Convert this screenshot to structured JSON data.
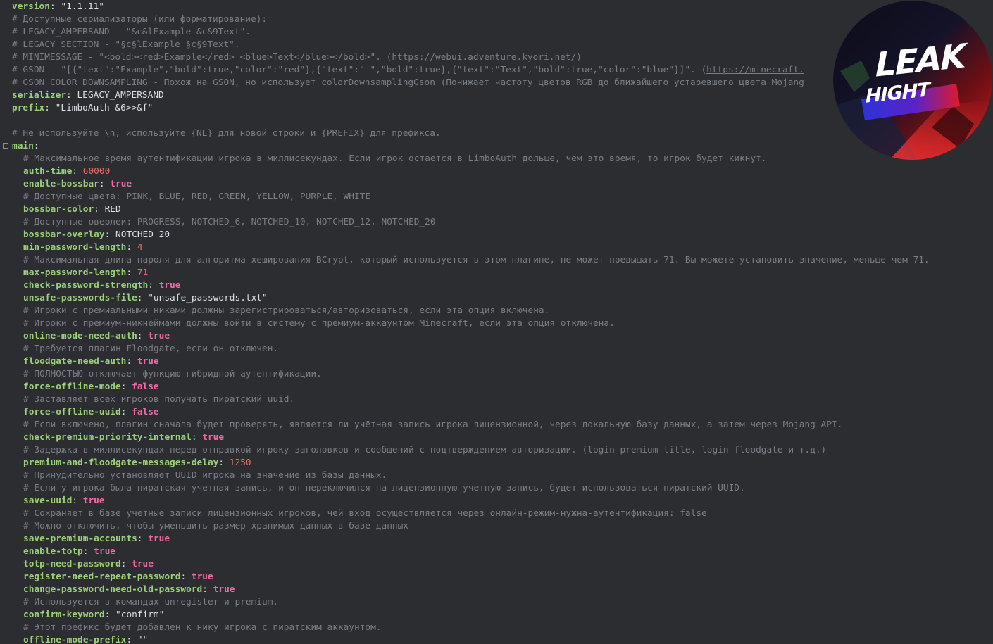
{
  "file": {
    "lines": [
      [
        {
          "t": "version",
          "c": "k"
        },
        {
          "t": ": ",
          "c": "p"
        },
        {
          "t": "\"1.1.11\"",
          "c": "s"
        }
      ],
      [
        {
          "t": "# Доступные сериализаторы (или форматирование):",
          "c": "c"
        }
      ],
      [
        {
          "t": "# LEGACY_AMPERSAND - \"&c&lExample &c&9Text\".",
          "c": "c"
        }
      ],
      [
        {
          "t": "# LEGACY_SECTION - \"§c§lExample §c§9Text\".",
          "c": "c"
        }
      ],
      [
        {
          "t": "# MINIMESSAGE - \"<bold><red>Example</red> <blue>Text</blue></bold>\". (",
          "c": "c"
        },
        {
          "t": "https://webui.adventure.kyori.net/",
          "c": "c u"
        },
        {
          "t": ")",
          "c": "c"
        }
      ],
      [
        {
          "t": "# GSON - \"[{\"text\":\"Example\",\"bold\":true,\"color\":\"red\"},{\"text\":\" \",\"bold\":true},{\"text\":\"Text\",\"bold\":true,\"color\":\"blue\"}]\". (",
          "c": "c"
        },
        {
          "t": "https://minecraft.",
          "c": "c u"
        }
      ],
      [
        {
          "t": "# GSON_COLOR_DOWNSAMPLING - Похож на GSON, но использует colorDownsamplingGson (Понижает частоту цветов RGB до ближайшего устаревшего цвета Mojang",
          "c": "c"
        }
      ],
      [
        {
          "t": "serializer",
          "c": "k"
        },
        {
          "t": ": ",
          "c": "p"
        },
        {
          "t": "LEGACY_AMPERSAND",
          "c": "s"
        }
      ],
      [
        {
          "t": "prefix",
          "c": "k"
        },
        {
          "t": ": ",
          "c": "p"
        },
        {
          "t": "\"LimboAuth &6>>&f\"",
          "c": "s"
        }
      ],
      [],
      [
        {
          "t": "# Не используйте \\n, используйте {NL} для новой строки и {PREFIX} для префикса.",
          "c": "c"
        }
      ],
      [
        {
          "t": "main",
          "c": "k"
        },
        {
          "t": ":",
          "c": "p"
        }
      ],
      [
        {
          "t": "# Максимальное время аутентификации игрока в миллисекундах. Если игрок остается в LimboAuth дольше, чем это время, то игрок будет кикнут.",
          "c": "c"
        }
      ],
      [
        {
          "t": "auth-time",
          "c": "k"
        },
        {
          "t": ": ",
          "c": "p"
        },
        {
          "t": "60000",
          "c": "n"
        }
      ],
      [
        {
          "t": "enable-bossbar",
          "c": "k"
        },
        {
          "t": ": ",
          "c": "p"
        },
        {
          "t": "true",
          "c": "b"
        }
      ],
      [
        {
          "t": "# Доступные цвета: PINK, BLUE, RED, GREEN, YELLOW, PURPLE, WHITE",
          "c": "c"
        }
      ],
      [
        {
          "t": "bossbar-color",
          "c": "k"
        },
        {
          "t": ": ",
          "c": "p"
        },
        {
          "t": "RED",
          "c": "s"
        }
      ],
      [
        {
          "t": "# Доступные оверлеи: PROGRESS, NOTCHED_6, NOTCHED_10, NOTCHED_12, NOTCHED_20",
          "c": "c"
        }
      ],
      [
        {
          "t": "bossbar-overlay",
          "c": "k"
        },
        {
          "t": ": ",
          "c": "p"
        },
        {
          "t": "NOTCHED_20",
          "c": "s"
        }
      ],
      [
        {
          "t": "min-password-length",
          "c": "k"
        },
        {
          "t": ": ",
          "c": "p"
        },
        {
          "t": "4",
          "c": "n"
        }
      ],
      [
        {
          "t": "# Максимальная длина пароля для алгоритма хеширования BCrypt, который используется в этом плагине, не может превышать 71. Вы можете установить значение, меньше чем 71.",
          "c": "c"
        }
      ],
      [
        {
          "t": "max-password-length",
          "c": "k"
        },
        {
          "t": ": ",
          "c": "p"
        },
        {
          "t": "71",
          "c": "n"
        }
      ],
      [
        {
          "t": "check-password-strength",
          "c": "k"
        },
        {
          "t": ": ",
          "c": "p"
        },
        {
          "t": "true",
          "c": "b"
        }
      ],
      [
        {
          "t": "unsafe-passwords-file",
          "c": "k"
        },
        {
          "t": ": ",
          "c": "p"
        },
        {
          "t": "\"unsafe_passwords.txt\"",
          "c": "s"
        }
      ],
      [
        {
          "t": "# Игроки с премиальными никами должны зарегистрироваться/авторизоваться, если эта опция включена.",
          "c": "c"
        }
      ],
      [
        {
          "t": "# Игроки с премиум-никнеймами должны войти в систему с премиум-аккаунтом Minecraft, если эта опция отключена.",
          "c": "c"
        }
      ],
      [
        {
          "t": "online-mode-need-auth",
          "c": "k"
        },
        {
          "t": ": ",
          "c": "p"
        },
        {
          "t": "true",
          "c": "b"
        }
      ],
      [
        {
          "t": "# Требуется плагин Floodgate, если он отключен.",
          "c": "c"
        }
      ],
      [
        {
          "t": "floodgate-need-auth",
          "c": "k"
        },
        {
          "t": ": ",
          "c": "p"
        },
        {
          "t": "true",
          "c": "b"
        }
      ],
      [
        {
          "t": "# ПОЛНОСТЬЮ отключает функцию гибридной аутентификации.",
          "c": "c"
        }
      ],
      [
        {
          "t": "force-offline-mode",
          "c": "k"
        },
        {
          "t": ": ",
          "c": "p"
        },
        {
          "t": "false",
          "c": "b"
        }
      ],
      [
        {
          "t": "# Заставляет всех игроков получать пиратский uuid.",
          "c": "c"
        }
      ],
      [
        {
          "t": "force-offline-uuid",
          "c": "k"
        },
        {
          "t": ": ",
          "c": "p"
        },
        {
          "t": "false",
          "c": "b"
        }
      ],
      [
        {
          "t": "# Если включено, плагин сначала будет проверять, является ли учётная запись игрока лицензионной, через локальную базу данных, а затем через Mojang API.",
          "c": "c"
        }
      ],
      [
        {
          "t": "check-premium-priority-internal",
          "c": "k"
        },
        {
          "t": ": ",
          "c": "p"
        },
        {
          "t": "true",
          "c": "b"
        }
      ],
      [
        {
          "t": "# Задержка в миллисекундах перед отправкой игроку заголовков и сообщений с подтверждением авторизации. (login-premium-title, login-floodgate и т.д.)",
          "c": "c"
        }
      ],
      [
        {
          "t": "premium-and-floodgate-messages-delay",
          "c": "k"
        },
        {
          "t": ": ",
          "c": "p"
        },
        {
          "t": "1250",
          "c": "n"
        }
      ],
      [
        {
          "t": "# Принудительно установляет UUID игрока на значение из базы данных.",
          "c": "c"
        }
      ],
      [
        {
          "t": "# Если у игрока была пиратская учетная запись, и он переключился на лицензионную учетную запись, будет использоваться пиратский UUID.",
          "c": "c"
        }
      ],
      [
        {
          "t": "save-uuid",
          "c": "k"
        },
        {
          "t": ": ",
          "c": "p"
        },
        {
          "t": "true",
          "c": "b"
        }
      ],
      [
        {
          "t": "# Сохраняет в базе учетные записи лицензионных игроков, чей вход осуществляется через онлайн-режим-нужна-аутентификация: false",
          "c": "c"
        }
      ],
      [
        {
          "t": "# Можно отключить, чтобы уменьшить размер хранимых данных в базе данных",
          "c": "c"
        }
      ],
      [
        {
          "t": "save-premium-accounts",
          "c": "k"
        },
        {
          "t": ": ",
          "c": "p"
        },
        {
          "t": "true",
          "c": "b"
        }
      ],
      [
        {
          "t": "enable-totp",
          "c": "k"
        },
        {
          "t": ": ",
          "c": "p"
        },
        {
          "t": "true",
          "c": "b"
        }
      ],
      [
        {
          "t": "totp-need-password",
          "c": "k"
        },
        {
          "t": ": ",
          "c": "p"
        },
        {
          "t": "true",
          "c": "b"
        }
      ],
      [
        {
          "t": "register-need-repeat-password",
          "c": "k"
        },
        {
          "t": ": ",
          "c": "p"
        },
        {
          "t": "true",
          "c": "b"
        }
      ],
      [
        {
          "t": "change-password-need-old-password",
          "c": "k"
        },
        {
          "t": ": ",
          "c": "p"
        },
        {
          "t": "true",
          "c": "b"
        }
      ],
      [
        {
          "t": "# Используется в командах unregister и premium.",
          "c": "c"
        }
      ],
      [
        {
          "t": "confirm-keyword",
          "c": "k"
        },
        {
          "t": ": ",
          "c": "p"
        },
        {
          "t": "\"confirm\"",
          "c": "s"
        }
      ],
      [
        {
          "t": "# Этот префикс будет добавлен к нику игрока с пиратским аккаунтом.",
          "c": "c"
        }
      ],
      [
        {
          "t": "offline-mode-prefix",
          "c": "k"
        },
        {
          "t": ": ",
          "c": "p"
        },
        {
          "t": "\"\"",
          "c": "s"
        }
      ]
    ]
  },
  "watermark": {
    "line1": "LEAK",
    "line2": "HIGHT"
  },
  "colors": {
    "background": "#2b2d31",
    "key": "#9ad179",
    "comment": "#7a7e85",
    "number": "#f06a6a",
    "boolean": "#f06aa8",
    "text": "#dcdfe4"
  }
}
